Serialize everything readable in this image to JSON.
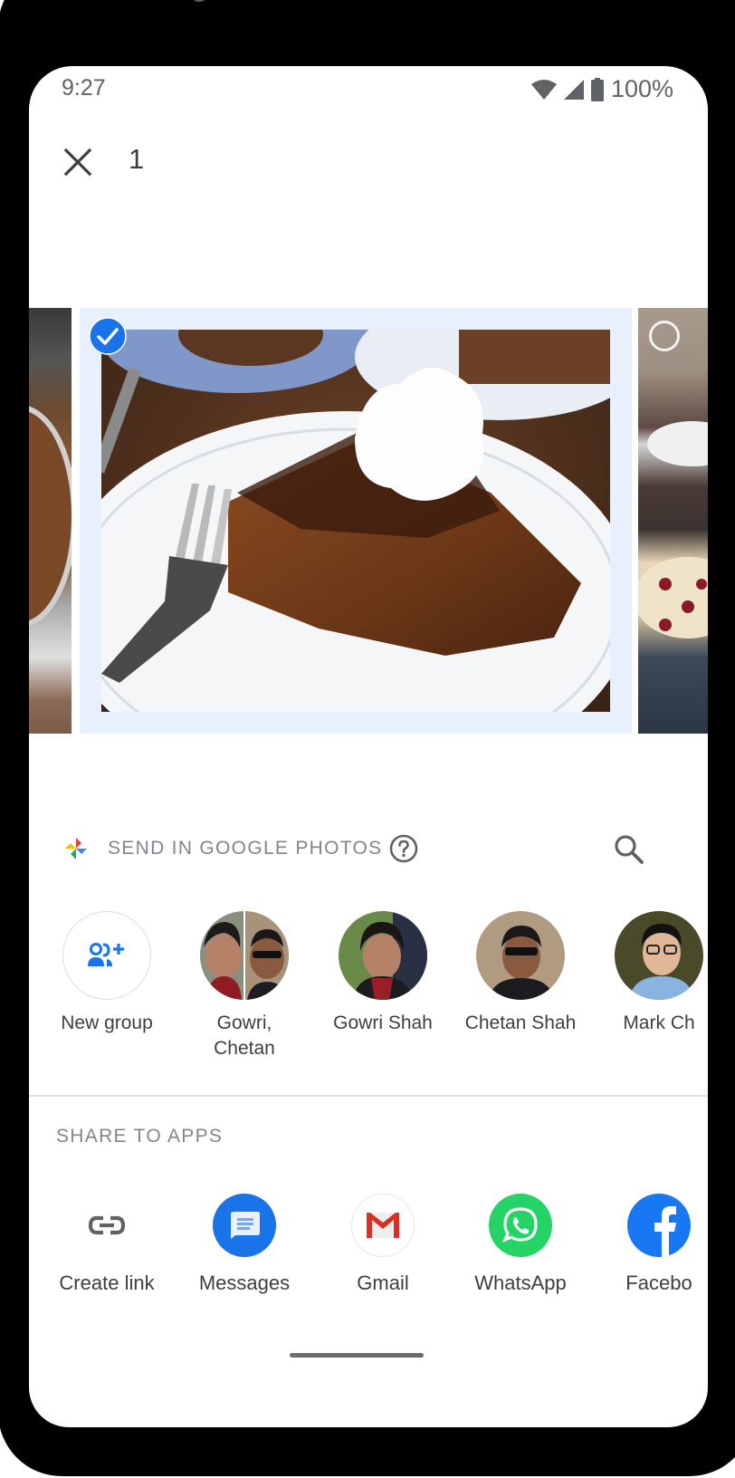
{
  "status_bar": {
    "time": "9:27",
    "battery_percent": "100%",
    "icons": [
      "wifi-icon",
      "signal-icon",
      "battery-icon"
    ]
  },
  "top_bar": {
    "close_icon": "close-icon",
    "selected_count": "1"
  },
  "carousel": {
    "items": [
      {
        "description": "pie in foil tin (partial)",
        "selected": false
      },
      {
        "description": "slice of pie with whipped cream and fork on white plate",
        "selected": true
      },
      {
        "description": "table with cookies (partial)",
        "selected": false
      }
    ]
  },
  "send_section": {
    "title": "SEND IN GOOGLE PHOTOS",
    "help_icon": "help-icon",
    "search_icon": "search-icon",
    "contacts": [
      {
        "label": "New group",
        "type": "new-group"
      },
      {
        "label": "Gowri,\nChetan",
        "line1": "Gowri,",
        "line2": "Chetan",
        "type": "group"
      },
      {
        "label": "Gowri Shah",
        "type": "person"
      },
      {
        "label": "Chetan Shah",
        "type": "person"
      },
      {
        "label": "Mark Ch",
        "type": "person"
      }
    ]
  },
  "share_section": {
    "title": "SHARE TO APPS",
    "apps": [
      {
        "label": "Create link",
        "icon": "link-icon"
      },
      {
        "label": "Messages",
        "icon": "messages-icon",
        "color": "#1a73e8"
      },
      {
        "label": "Gmail",
        "icon": "gmail-icon",
        "color": "#ea4335"
      },
      {
        "label": "WhatsApp",
        "icon": "whatsapp-icon",
        "color": "#25d366"
      },
      {
        "label": "Facebo",
        "icon": "facebook-icon",
        "color": "#1877f2"
      }
    ]
  },
  "colors": {
    "accent": "#1a73e8",
    "selection_bg": "#e8f0fe",
    "text_secondary": "#80868b",
    "text_primary": "#3c4043"
  }
}
